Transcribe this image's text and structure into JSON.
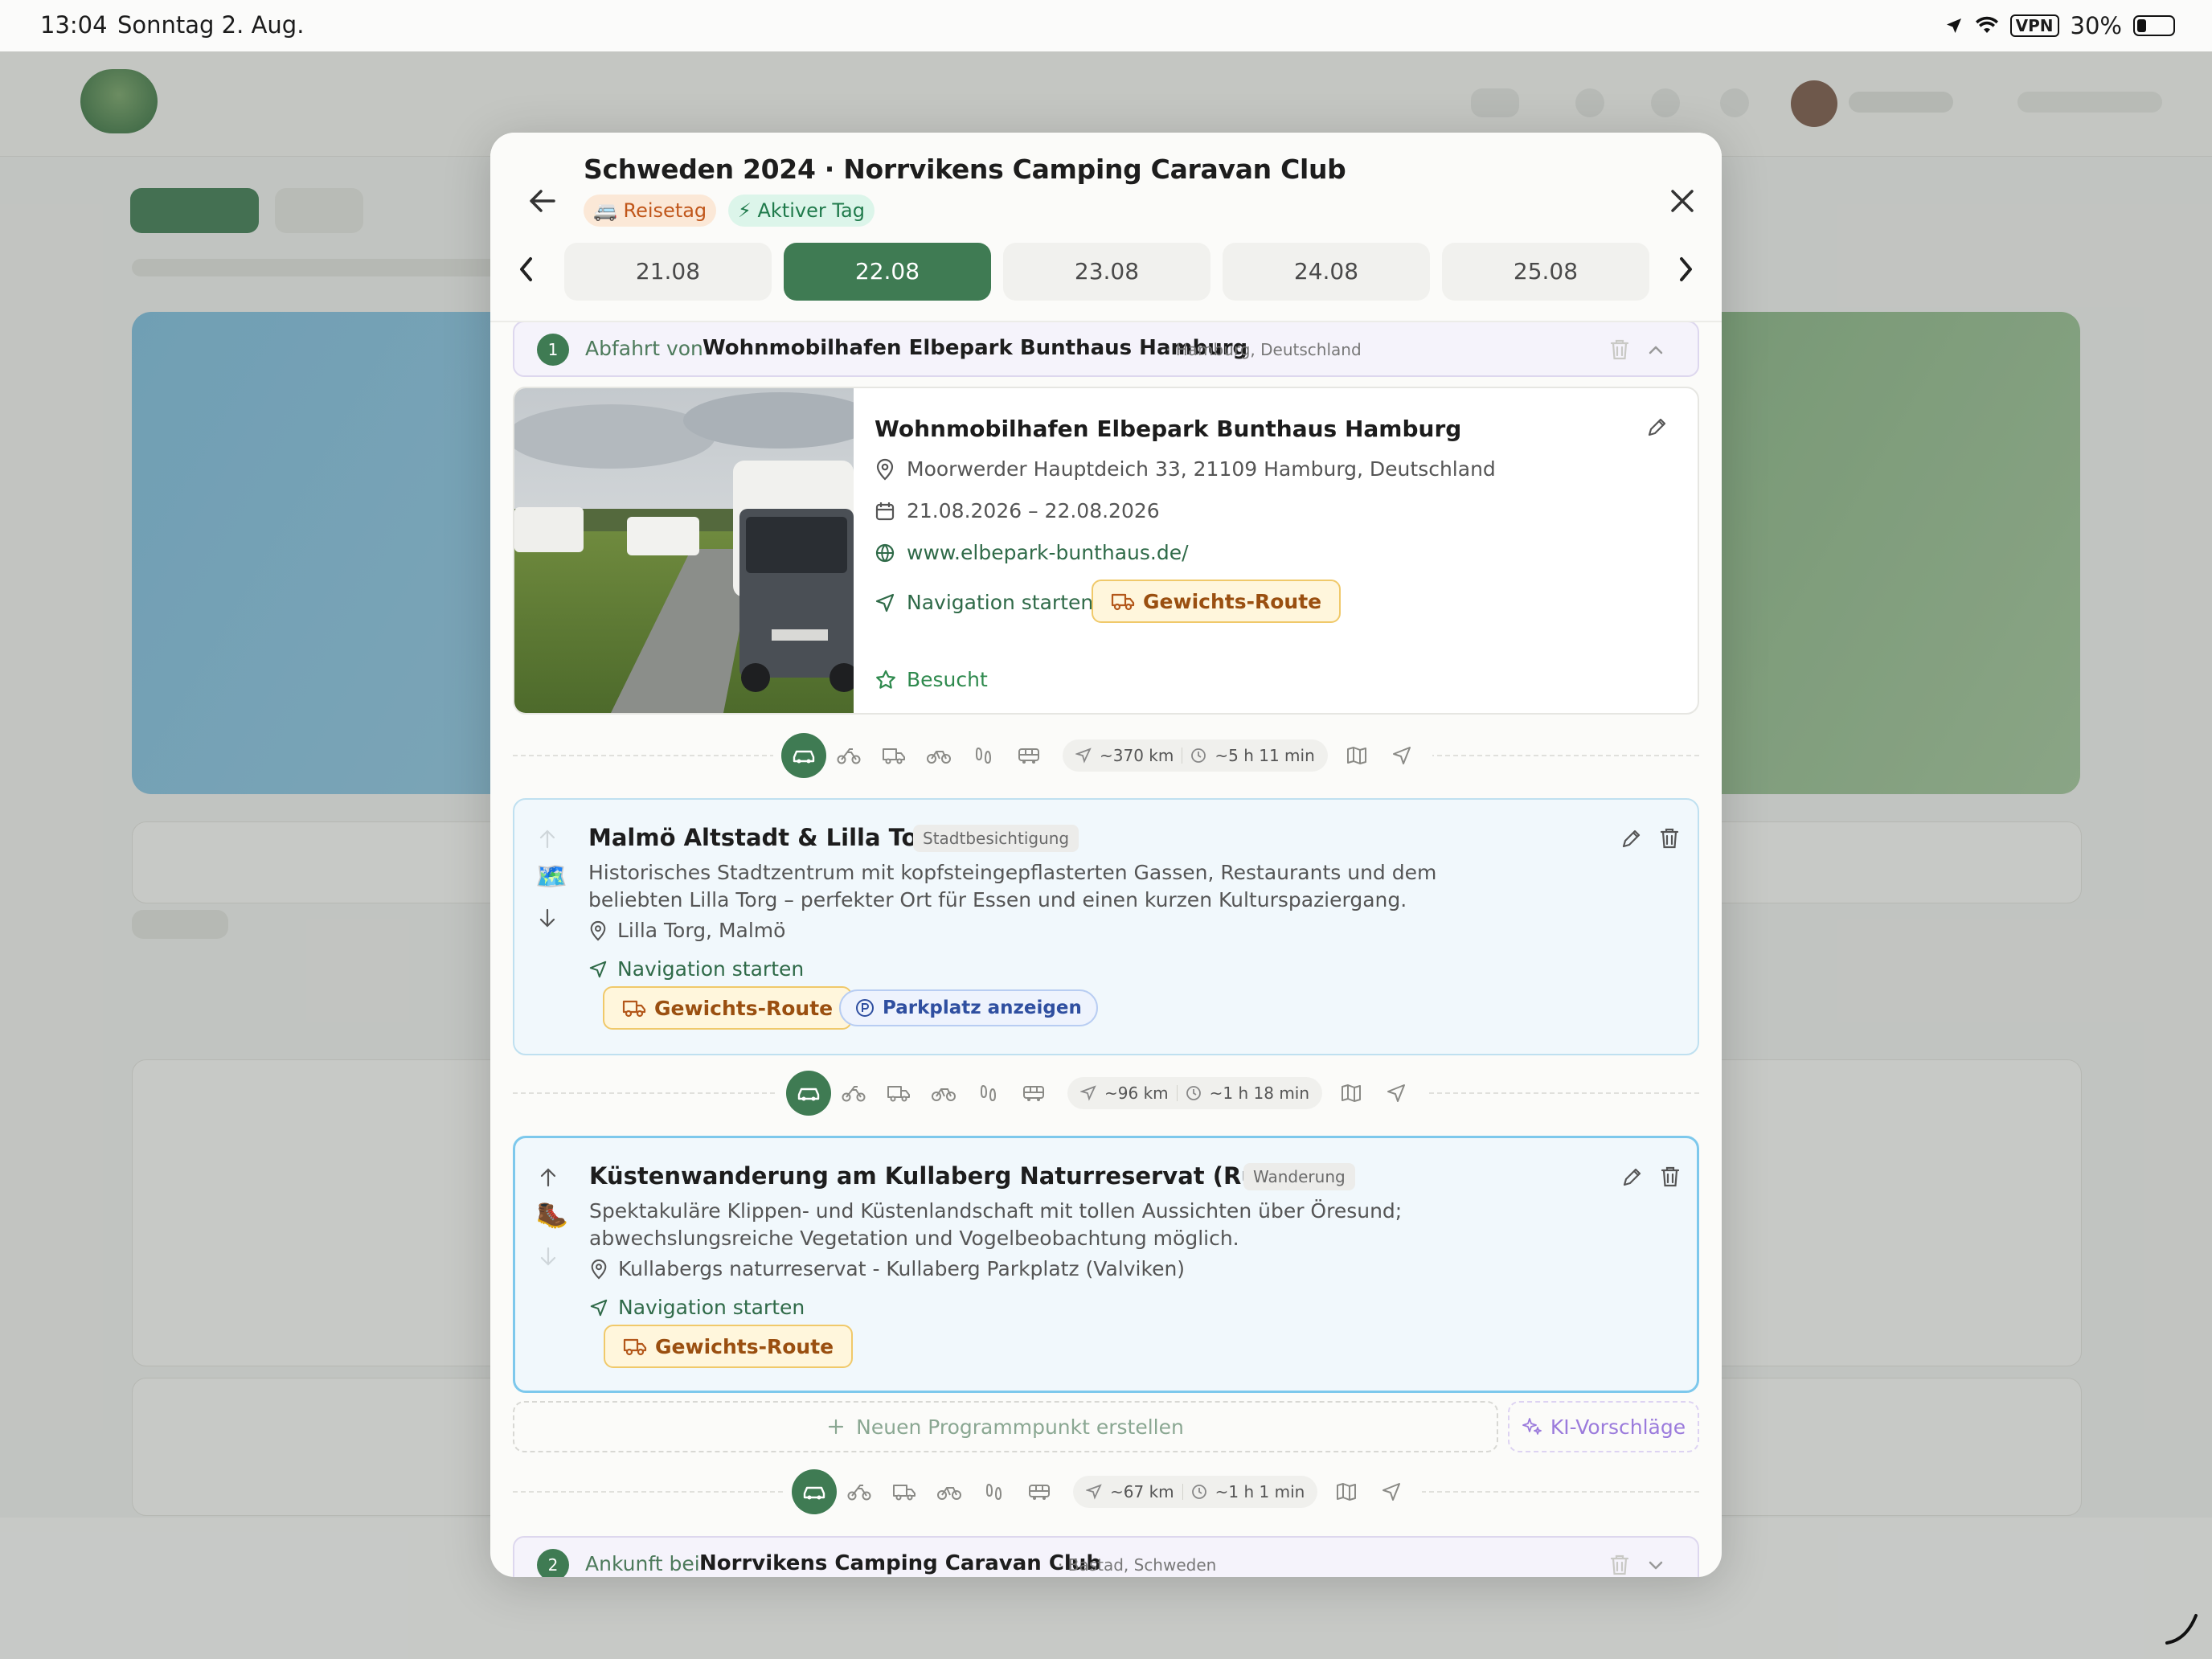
{
  "status_bar": {
    "time": "13:04",
    "date": "Sonntag 2. Aug.",
    "vpn": "VPN",
    "battery": "30%"
  },
  "modal": {
    "title": "Schweden 2024 · Norrvikens Camping Caravan Club",
    "badges": {
      "reisetag": "Reisetag",
      "aktiv": "Aktiver Tag"
    },
    "dates": [
      "21.08",
      "22.08",
      "23.08",
      "24.08",
      "25.08"
    ],
    "active_date": "22.08"
  },
  "departure": {
    "number": "1",
    "label": "Abfahrt von",
    "name": "Wohnmobilhafen Elbepark Bunthaus Hamburg",
    "location": "· Hamburg, Deutschland",
    "card": {
      "title": "Wohnmobilhafen Elbepark Bunthaus Hamburg",
      "address": "Moorwerder Hauptdeich 33, 21109 Hamburg, Deutschland",
      "dates": "21.08.2026 – 22.08.2026",
      "website": "www.elbepark-bunthaus.de/",
      "navigate": "Navigation starten",
      "weight_route": "Gewichts-Route",
      "visited": "Besucht"
    }
  },
  "travel_segments": [
    {
      "distance": "~370 km",
      "duration": "~5 h 11 min"
    },
    {
      "distance": "~96 km",
      "duration": "~1 h 18 min"
    },
    {
      "distance": "~67 km",
      "duration": "~1 h 1 min"
    }
  ],
  "program_items": [
    {
      "title": "Malmö Altstadt & Lilla Torg",
      "category": "Stadtbesichtigung",
      "emoji": "🗺️",
      "description": "Historisches Stadtzentrum mit kopfsteingepflasterten Gassen, Restaurants und dem beliebten Lilla Torg – perfekter Ort für Essen und einen kurzen Kulturspaziergang.",
      "location": "Lilla Torg, Malmö",
      "navigate": "Navigation starten",
      "weight_route": "Gewichts-Route",
      "parking": "Parkplatz anzeigen"
    },
    {
      "title": "Küstenwanderung am Kullaberg Naturreservat (Rundweg)",
      "category": "Wanderung",
      "emoji": "🥾",
      "description": "Spektakuläre Klippen- und Küstenlandschaft mit tollen Aussichten über Öresund; abwechslungsreiche Vegetation und Vogelbeobachtung möglich.",
      "location": "Kullabergs naturreservat - Kullaberg Parkplatz (Valviken)",
      "navigate": "Navigation starten",
      "weight_route": "Gewichts-Route"
    }
  ],
  "actions": {
    "new_item": "Neuen Programmpunkt erstellen",
    "ai_suggestions": "KI-Vorschläge"
  },
  "arrival": {
    "number": "2",
    "label": "Ankunft bei",
    "name": "Norrvikens Camping Caravan Club",
    "location": "· Bastad, Schweden"
  },
  "colors": {
    "primary_green": "#3f7b53",
    "program_bg": "#f1f8fc",
    "program_border": "#bfe0f0",
    "weight_route_bg": "#fff6dc",
    "weight_route_text": "#9a4f10",
    "parking_text": "#2f4fa0",
    "ai_purple": "#9b7bdc"
  }
}
